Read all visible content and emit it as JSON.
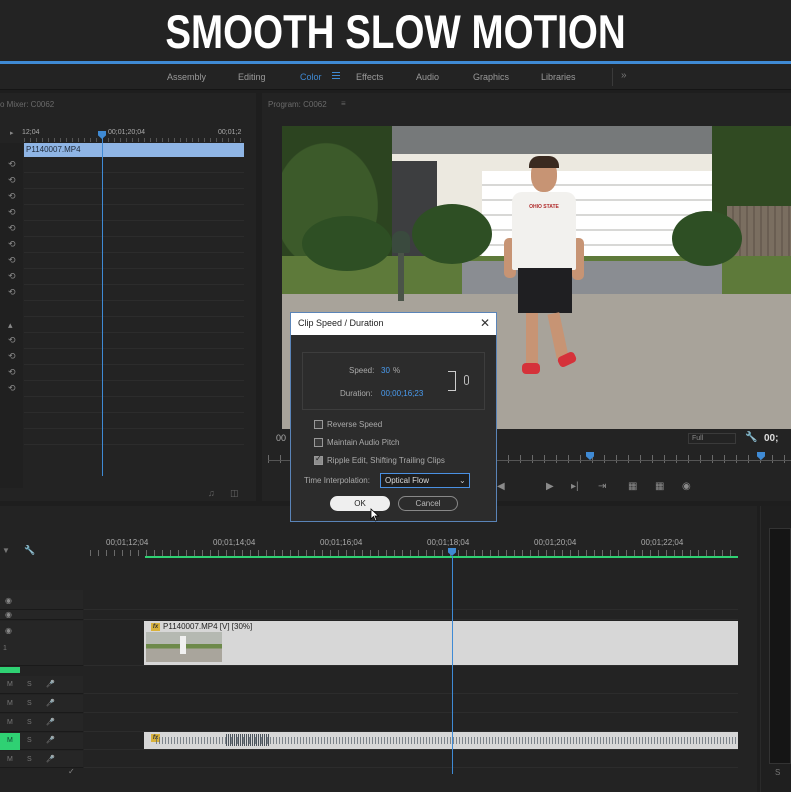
{
  "banner": {
    "title": "SMOOTH SLOW MOTION"
  },
  "workspaces": {
    "tabs": [
      {
        "label": "Assembly"
      },
      {
        "label": "Editing"
      },
      {
        "label": "Color"
      },
      {
        "label": "Effects"
      },
      {
        "label": "Audio"
      },
      {
        "label": "Graphics"
      },
      {
        "label": "Libraries"
      }
    ],
    "active": "Color",
    "more": "»"
  },
  "left_panel": {
    "title": "o Mixer: C0062",
    "timecodes": [
      "12;04",
      "00;01;20;04",
      "00;01;2"
    ],
    "clip_name": "P1140007.MP4"
  },
  "program_panel": {
    "title": "Program: C0062",
    "timecode_left": "00",
    "timecode_right": "00;",
    "fit": "Full",
    "shirt_text": "OHIO STATE"
  },
  "timeline": {
    "timecodes": [
      "00;01;12;04",
      "00;01;14;04",
      "00;01;16;04",
      "00;01;18;04",
      "00;01;20;04",
      "00;01;22;04"
    ],
    "video_clip_label": "P1140007.MP4 [V] [30%]",
    "fx": "fx",
    "track_label": "1",
    "mute": "M",
    "solo": "S"
  },
  "dialog": {
    "title": "Clip Speed / Duration",
    "speed_label": "Speed:",
    "speed_value": "30",
    "speed_unit": "%",
    "duration_label": "Duration:",
    "duration_value": "00;00;16;23",
    "options": [
      {
        "label": "Reverse Speed",
        "checked": false
      },
      {
        "label": "Maintain Audio Pitch",
        "checked": false
      },
      {
        "label": "Ripple Edit, Shifting Trailing Clips",
        "checked": true
      }
    ],
    "interpolation_label": "Time Interpolation:",
    "interpolation_value": "Optical Flow",
    "ok_label": "OK",
    "cancel_label": "Cancel"
  },
  "colors": {
    "accent": "#3f8ad4",
    "green": "#2fd173",
    "clip": "#d7d7d7"
  }
}
